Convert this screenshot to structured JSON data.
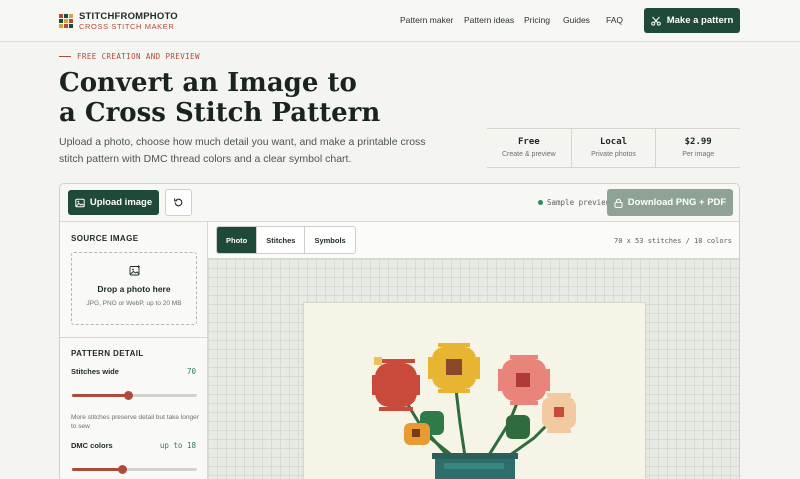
{
  "brand": {
    "name": "STITCHFROMPHOTO",
    "tagline": "CROSS STITCH MAKER",
    "colors": {
      "primary": "#1f4a38",
      "accent": "#b04a3a"
    }
  },
  "nav": {
    "items": [
      "Pattern maker",
      "Pattern ideas",
      "Pricing",
      "Guides",
      "FAQ"
    ],
    "cta": "Make a pattern"
  },
  "hero": {
    "eyebrow": "FREE CREATION AND PREVIEW",
    "title_line1": "Convert an Image to",
    "title_line2": "a Cross Stitch Pattern",
    "subtitle": "Upload a photo, choose how much detail you want, and make a printable cross stitch pattern with DMC thread colors and a clear symbol chart."
  },
  "stats": [
    {
      "value": "Free",
      "label": "Create & preview"
    },
    {
      "value": "Local",
      "label": "Private photos"
    },
    {
      "value": "$2.99",
      "label": "Per image"
    }
  ],
  "toolbar": {
    "upload_label": "Upload image",
    "sample_label": "Sample preview",
    "download_label": "Download PNG + PDF"
  },
  "sidebar": {
    "source_title": "SOURCE IMAGE",
    "drop_title": "Drop a photo here",
    "drop_sub": "JPG, PNG or WebP, up to 20 MB",
    "detail_title": "PATTERN DETAIL",
    "stitches_label": "Stitches wide",
    "stitches_value": "70",
    "stitches_slider": 0.45,
    "hint": "More stitches preserve detail but take longer to sew",
    "colors_label": "DMC colors",
    "colors_value": "up to 18",
    "colors_slider": 0.4
  },
  "preview": {
    "tabs": [
      "Photo",
      "Stitches",
      "Symbols"
    ],
    "active_tab": "Photo",
    "info": "70 x 53 stitches / 18 colors"
  }
}
